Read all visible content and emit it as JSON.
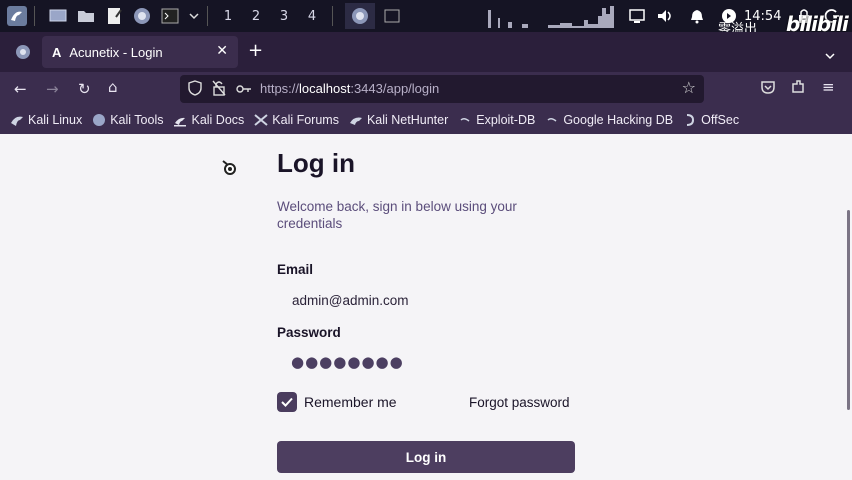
{
  "taskbar": {
    "workspaces": [
      "1",
      "2",
      "3",
      "4"
    ],
    "clock": "14:54",
    "watermark_cn": "零溢出",
    "watermark_logo": "bilibili"
  },
  "browser": {
    "tab_title": "Acunetix - Login",
    "url_prefix": "https://",
    "url_host": "localhost",
    "url_rest": ":3443/app/login",
    "bookmarks": [
      {
        "label": "Kali Linux"
      },
      {
        "label": "Kali Tools"
      },
      {
        "label": "Kali Docs"
      },
      {
        "label": "Kali Forums"
      },
      {
        "label": "Kali NetHunter"
      },
      {
        "label": "Exploit-DB"
      },
      {
        "label": "Google Hacking DB"
      },
      {
        "label": "OffSec"
      }
    ]
  },
  "login": {
    "title": "Log in",
    "subtitle": "Welcome back, sign in below using your credentials",
    "email_label": "Email",
    "email_value": "admin@admin.com",
    "password_label": "Password",
    "password_mask": "●●●●●●●●",
    "remember_label": "Remember me",
    "remember_checked": true,
    "forgot_label": "Forgot password",
    "submit_label": "Log in"
  },
  "colors": {
    "accent": "#4d3e60",
    "page_bg": "#f5f4f7",
    "browser_chrome": "#3b2d4e"
  }
}
